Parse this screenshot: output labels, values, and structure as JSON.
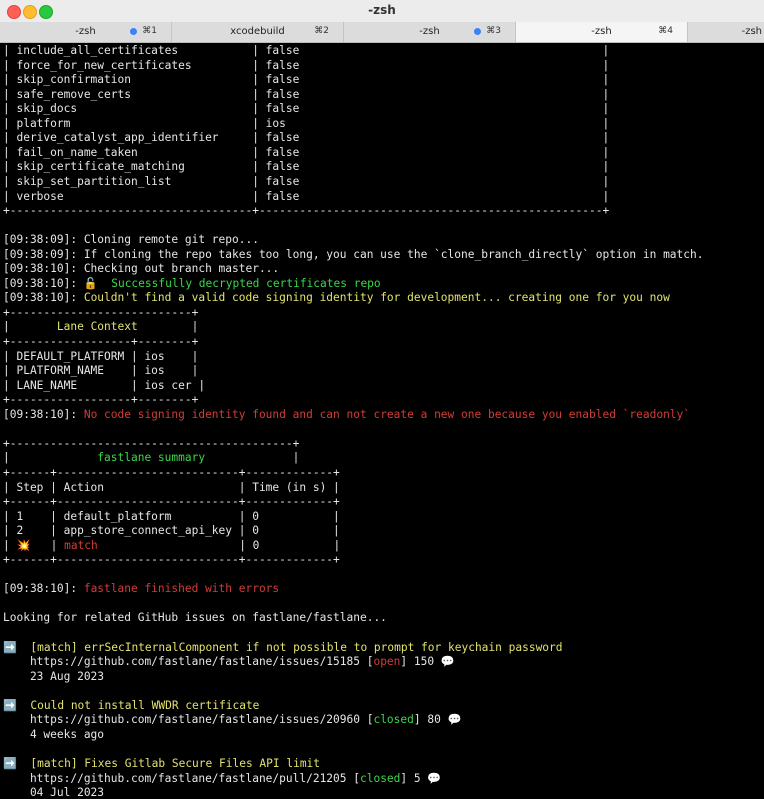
{
  "window": {
    "title": "-zsh"
  },
  "tabs": [
    {
      "label": "-zsh",
      "shortcut": "⌘1",
      "dot": true
    },
    {
      "label": "xcodebuild",
      "shortcut": "⌘2",
      "dot": false
    },
    {
      "label": "-zsh",
      "shortcut": "⌘3",
      "dot": true
    },
    {
      "label": "-zsh",
      "shortcut": "⌘4",
      "dot": false,
      "active": true
    },
    {
      "label": "-zsh",
      "shortcut": "",
      "dot": false
    }
  ],
  "colors": {
    "red": "#d33c36",
    "yellow": "#e2e26f",
    "green": "#3bd64a",
    "text": "#e6e6e6",
    "background": "#000000"
  },
  "terminal": {
    "lines": [
      [
        {
          "t": "| include_all_certificates           | false                                             |"
        }
      ],
      [
        {
          "t": "| force_for_new_certificates         | false                                             |"
        }
      ],
      [
        {
          "t": "| skip_confirmation                  | false                                             |"
        }
      ],
      [
        {
          "t": "| safe_remove_certs                  | false                                             |"
        }
      ],
      [
        {
          "t": "| skip_docs                          | false                                             |"
        }
      ],
      [
        {
          "t": "| platform                           | ios                                               |"
        }
      ],
      [
        {
          "t": "| derive_catalyst_app_identifier     | false                                             |"
        }
      ],
      [
        {
          "t": "| fail_on_name_taken                 | false                                             |"
        }
      ],
      [
        {
          "t": "| skip_certificate_matching          | false                                             |"
        }
      ],
      [
        {
          "t": "| skip_set_partition_list            | false                                             |"
        }
      ],
      [
        {
          "t": "| verbose                            | false                                             |"
        }
      ],
      [
        {
          "t": "+------------------------------------+---------------------------------------------------+"
        }
      ],
      [],
      [
        {
          "t": "[09:38:09]: Cloning remote git repo..."
        }
      ],
      [
        {
          "t": "[09:38:09]: If cloning the repo takes too long, you can use the `clone_branch_directly` option in match."
        }
      ],
      [
        {
          "t": "[09:38:10]: Checking out branch master..."
        }
      ],
      [
        {
          "t": "[09:38:10]: "
        },
        {
          "t": "🔓  Successfully decrypted certificates repo",
          "c": "green"
        }
      ],
      [
        {
          "t": "[09:38:10]: "
        },
        {
          "t": "Couldn't find a valid code signing identity for development... creating one for you now",
          "c": "yellow"
        }
      ],
      [
        {
          "t": "+---------------------------+"
        }
      ],
      [
        {
          "t": "|       "
        },
        {
          "t": "Lane Context",
          "c": "yellow"
        },
        {
          "t": "        |"
        }
      ],
      [
        {
          "t": "+------------------+--------+"
        }
      ],
      [
        {
          "t": "| DEFAULT_PLATFORM | ios    |"
        }
      ],
      [
        {
          "t": "| PLATFORM_NAME    | ios    |"
        }
      ],
      [
        {
          "t": "| LANE_NAME        | ios cer |"
        }
      ],
      [
        {
          "t": "+------------------+--------+"
        }
      ],
      [
        {
          "t": "[09:38:10]: "
        },
        {
          "t": "No code signing identity found and can not create a new one because you enabled `readonly`",
          "c": "red"
        }
      ],
      [],
      [
        {
          "t": "+------------------------------------------+"
        }
      ],
      [
        {
          "t": "|             "
        },
        {
          "t": "fastlane summary",
          "c": "green"
        },
        {
          "t": "             |"
        }
      ],
      [
        {
          "t": "+------+---------------------------+-------------+"
        }
      ],
      [
        {
          "t": "| Step | Action                    | Time (in s) |"
        }
      ],
      [
        {
          "t": "+------+---------------------------+-------------+"
        }
      ],
      [
        {
          "t": "| 1    | default_platform          | 0           |"
        }
      ],
      [
        {
          "t": "| 2    | app_store_connect_api_key | 0           |"
        }
      ],
      [
        {
          "t": "| 💥   | "
        },
        {
          "t": "match",
          "c": "red"
        },
        {
          "t": "                     | 0           |"
        }
      ],
      [
        {
          "t": "+------+---------------------------+-------------+"
        }
      ],
      [],
      [
        {
          "t": "[09:38:10]: "
        },
        {
          "t": "fastlane finished with errors",
          "c": "red"
        }
      ],
      [],
      [
        {
          "t": "Looking for related GitHub issues on fastlane/fastlane..."
        }
      ],
      [],
      [
        {
          "t": "➡️  "
        },
        {
          "t": "[match] errSecInternalComponent if not possible to prompt for keychain password",
          "c": "yellow"
        }
      ],
      [
        {
          "t": "    https://github.com/fastlane/fastlane/issues/15185 ["
        },
        {
          "t": "open",
          "c": "red"
        },
        {
          "t": "] 150 💬"
        }
      ],
      [
        {
          "t": "    23 Aug 2023"
        }
      ],
      [],
      [
        {
          "t": "➡️  "
        },
        {
          "t": "Could not install WWDR certificate",
          "c": "yellow"
        }
      ],
      [
        {
          "t": "    https://github.com/fastlane/fastlane/issues/20960 ["
        },
        {
          "t": "closed",
          "c": "green"
        },
        {
          "t": "] 80 💬"
        }
      ],
      [
        {
          "t": "    4 weeks ago"
        }
      ],
      [],
      [
        {
          "t": "➡️  "
        },
        {
          "t": "[match] Fixes Gitlab Secure Files API limit",
          "c": "yellow"
        }
      ],
      [
        {
          "t": "    https://github.com/fastlane/fastlane/pull/21205 ["
        },
        {
          "t": "closed",
          "c": "green"
        },
        {
          "t": "] 5 💬"
        }
      ],
      [
        {
          "t": "    04 Jul 2023"
        }
      ]
    ]
  }
}
